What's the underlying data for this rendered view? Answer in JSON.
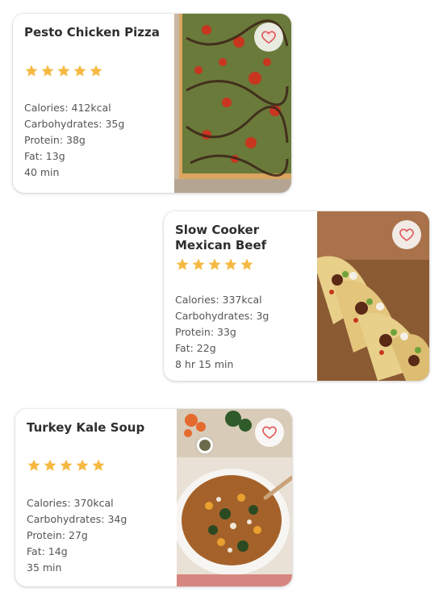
{
  "recipes": [
    {
      "title": "Pesto Chicken Pizza",
      "rating": 5,
      "calories": "Calories: 412kcal",
      "carbohydrates": "Carbohydrates: 35g",
      "protein": "Protein: 38g",
      "fat": "Fat: 13g",
      "time": "40 min",
      "favorite_icon": "heart-outline-icon"
    },
    {
      "title": "Slow Cooker Mexican Beef",
      "rating": 5,
      "calories": "Calories: 337kcal",
      "carbohydrates": "Carbohydrates: 3g",
      "protein": "Protein: 33g",
      "fat": "Fat: 22g",
      "time": "8 hr 15 min",
      "favorite_icon": "heart-outline-icon"
    },
    {
      "title": "Turkey Kale Soup",
      "rating": 5,
      "calories": "Calories: 370kcal",
      "carbohydrates": "Carbohydrates: 34g",
      "protein": "Protein: 27g",
      "fat": "Fat: 14g",
      "time": "35 min",
      "favorite_icon": "heart-outline-icon"
    }
  ],
  "colors": {
    "star": "#F5B942",
    "heart": "#E05A5A",
    "title": "#2e2e2e",
    "text": "#555555"
  }
}
